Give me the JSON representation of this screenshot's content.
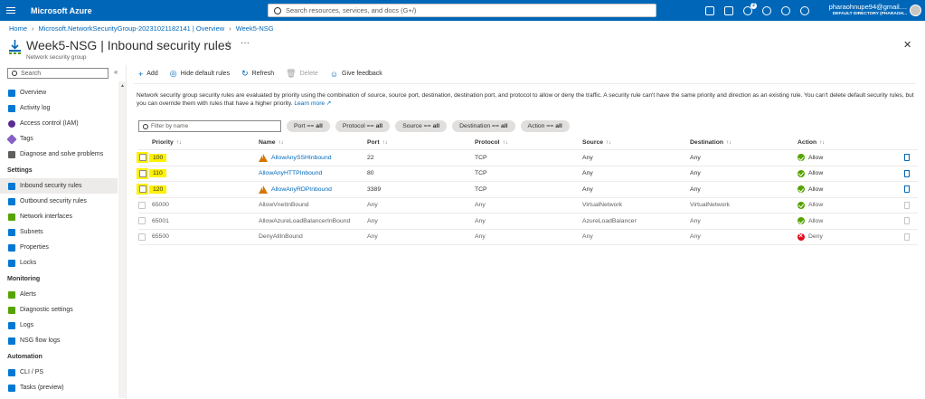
{
  "topbar": {
    "brand": "Microsoft Azure",
    "search_placeholder": "Search resources, services, and docs (G+/)",
    "notification_count": "2",
    "user": "pharaohnupe94@gmail....",
    "directory": "DEFAULT DIRECTORY (PHARAOH..."
  },
  "breadcrumb": [
    "Home",
    "Microsoft.NetworkSecurityGroup-20231021182141 | Overview",
    "Week5-NSG"
  ],
  "header": {
    "title": "Week5-NSG | Inbound security rules",
    "subtitle": "Network security group",
    "star": "☆",
    "more": "···",
    "close": "✕"
  },
  "sidebar": {
    "search_placeholder": "Search",
    "collapse": "«",
    "items": [
      {
        "label": "Overview",
        "color": "#0078d4"
      },
      {
        "label": "Activity log",
        "color": "#0078d4"
      },
      {
        "label": "Access control (IAM)",
        "color": "#5c2d91"
      },
      {
        "label": "Tags",
        "color": "#8661c5"
      },
      {
        "label": "Diagnose and solve problems",
        "color": "#605e5c"
      }
    ],
    "section_settings": "Settings",
    "settings_items": [
      {
        "label": "Inbound security rules",
        "color": "#0078d4",
        "active": true
      },
      {
        "label": "Outbound security rules",
        "color": "#0078d4"
      },
      {
        "label": "Network interfaces",
        "color": "#57a300"
      },
      {
        "label": "Subnets",
        "color": "#0078d4"
      },
      {
        "label": "Properties",
        "color": "#0078d4"
      },
      {
        "label": "Locks",
        "color": "#0078d4"
      }
    ],
    "section_monitoring": "Monitoring",
    "monitoring_items": [
      {
        "label": "Alerts",
        "color": "#57a300"
      },
      {
        "label": "Diagnostic settings",
        "color": "#57a300"
      },
      {
        "label": "Logs",
        "color": "#0078d4"
      },
      {
        "label": "NSG flow logs",
        "color": "#0078d4"
      }
    ],
    "section_automation": "Automation",
    "automation_items": [
      {
        "label": "CLI / PS",
        "color": "#0078d4"
      },
      {
        "label": "Tasks (preview)",
        "color": "#0078d4"
      }
    ]
  },
  "toolbar": {
    "add": "Add",
    "hide_default": "Hide default rules",
    "refresh": "Refresh",
    "delete": "Delete",
    "feedback": "Give feedback"
  },
  "description": {
    "text": "Network security group security rules are evaluated by priority using the combination of source, source port, destination, destination port, and protocol to allow or deny the traffic. A security rule can't have the same priority and direction as an existing rule. You can't delete default security rules, but you can override them with rules that have a higher priority.",
    "link": "Learn more"
  },
  "filters": {
    "name_placeholder": "Filter by name",
    "pills": [
      {
        "label": "Port ==",
        "value": "all"
      },
      {
        "label": "Protocol ==",
        "value": "all"
      },
      {
        "label": "Source ==",
        "value": "all"
      },
      {
        "label": "Destination ==",
        "value": "all"
      },
      {
        "label": "Action ==",
        "value": "all"
      }
    ]
  },
  "table": {
    "columns": [
      "Priority",
      "Name",
      "Port",
      "Protocol",
      "Source",
      "Destination",
      "Action"
    ],
    "sort_glyph": "↑↓",
    "rows": [
      {
        "priority": "100",
        "name": "AllowAnySSHInbound",
        "port": "22",
        "protocol": "TCP",
        "source": "Any",
        "destination": "Any",
        "action": "Allow",
        "custom": true,
        "warning": true
      },
      {
        "priority": "110",
        "name": "AllowAnyHTTPInbound",
        "port": "80",
        "protocol": "TCP",
        "source": "Any",
        "destination": "Any",
        "action": "Allow",
        "custom": true,
        "warning": false
      },
      {
        "priority": "120",
        "name": "AllowAnyRDPInbound",
        "port": "3389",
        "protocol": "TCP",
        "source": "Any",
        "destination": "Any",
        "action": "Allow",
        "custom": true,
        "warning": true
      },
      {
        "priority": "65000",
        "name": "AllowVnetInBound",
        "port": "Any",
        "protocol": "Any",
        "source": "VirtualNetwork",
        "destination": "VirtualNetwork",
        "action": "Allow",
        "custom": false,
        "warning": false
      },
      {
        "priority": "65001",
        "name": "AllowAzureLoadBalancerInBound",
        "port": "Any",
        "protocol": "Any",
        "source": "AzureLoadBalancer",
        "destination": "Any",
        "action": "Allow",
        "custom": false,
        "warning": false
      },
      {
        "priority": "65500",
        "name": "DenyAllInBound",
        "port": "Any",
        "protocol": "Any",
        "source": "Any",
        "destination": "Any",
        "action": "Deny",
        "custom": false,
        "warning": false
      }
    ]
  }
}
